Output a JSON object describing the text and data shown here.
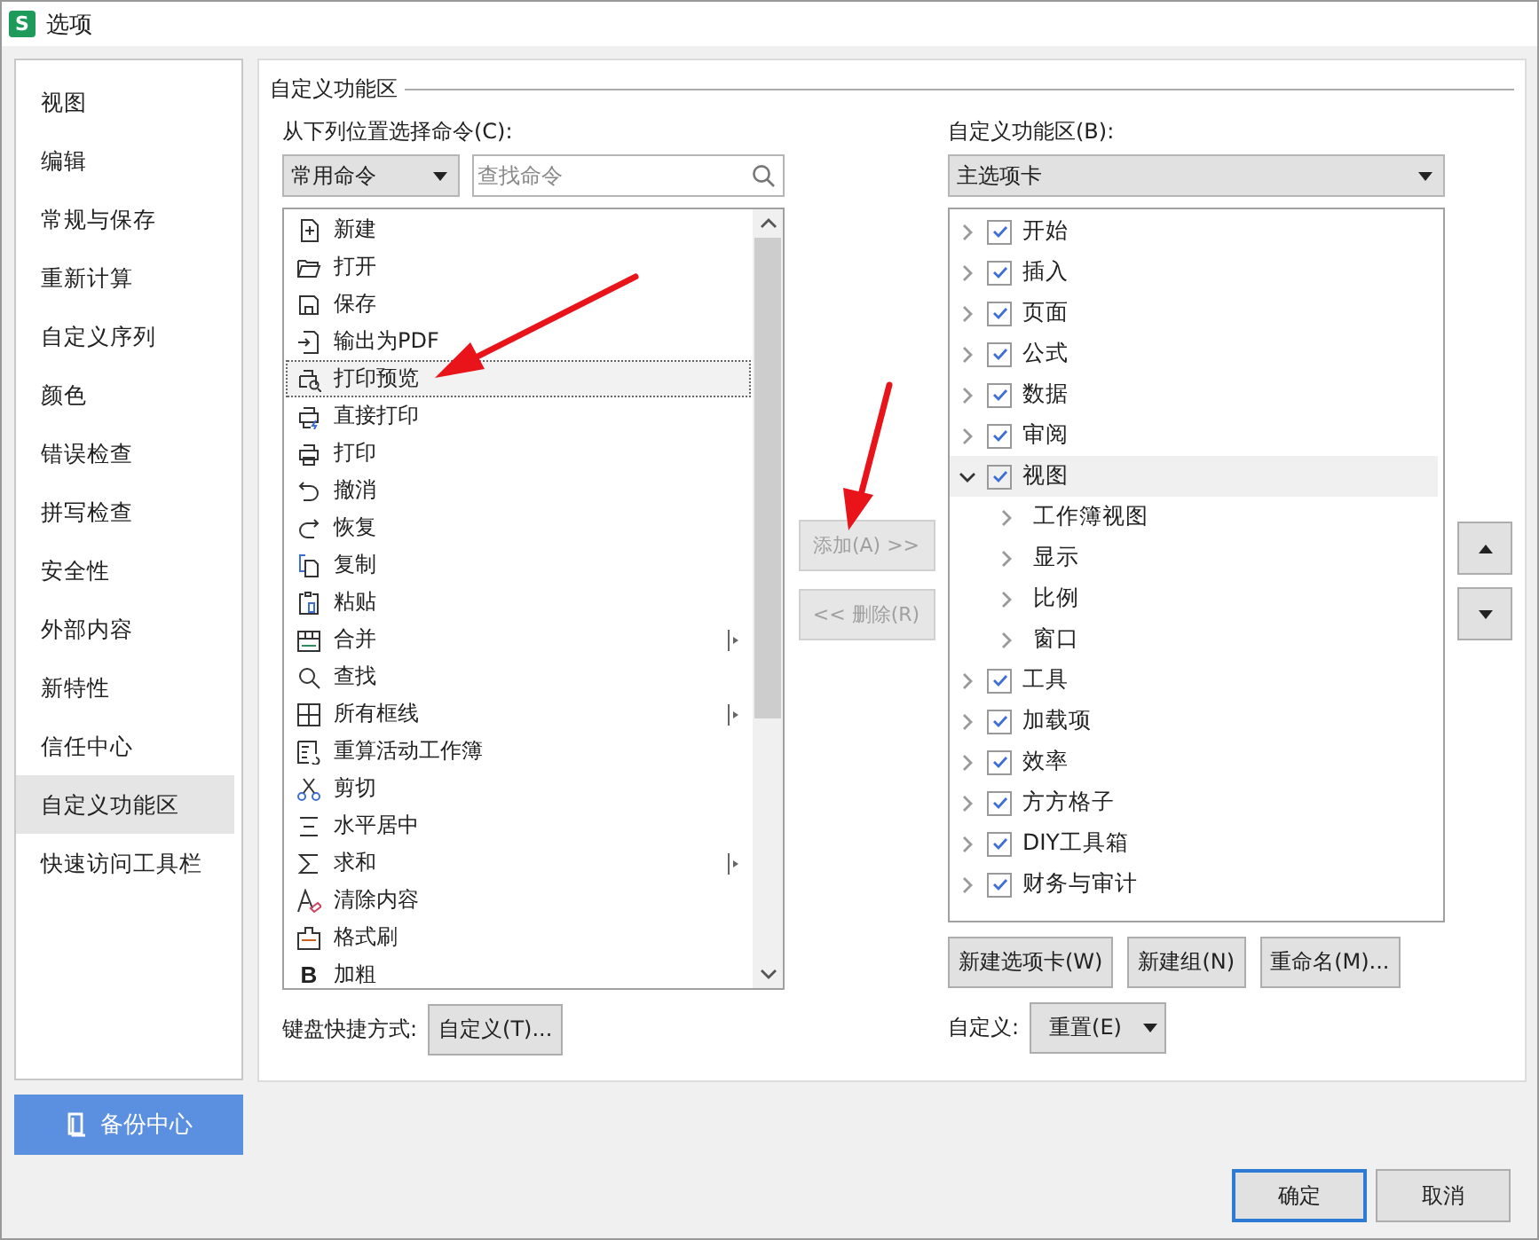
{
  "window": {
    "title": "选项",
    "logo": "S"
  },
  "sidebar": {
    "items": [
      {
        "label": "视图",
        "selected": false
      },
      {
        "label": "编辑",
        "selected": false
      },
      {
        "label": "常规与保存",
        "selected": false
      },
      {
        "label": "重新计算",
        "selected": false
      },
      {
        "label": "自定义序列",
        "selected": false
      },
      {
        "label": "颜色",
        "selected": false
      },
      {
        "label": "错误检查",
        "selected": false
      },
      {
        "label": "拼写检查",
        "selected": false
      },
      {
        "label": "安全性",
        "selected": false
      },
      {
        "label": "外部内容",
        "selected": false
      },
      {
        "label": "新特性",
        "selected": false
      },
      {
        "label": "信任中心",
        "selected": false
      },
      {
        "label": "自定义功能区",
        "selected": true
      },
      {
        "label": "快速访问工具栏",
        "selected": false
      }
    ],
    "backup_button": "备份中心"
  },
  "group_title": "自定义功能区",
  "commands": {
    "label": "从下列位置选择命令(C):",
    "dropdown": "常用命令",
    "search": {
      "placeholder": "查找命令"
    },
    "items": [
      {
        "label": "新建",
        "selected": false,
        "submenu": false
      },
      {
        "label": "打开",
        "selected": false,
        "submenu": false
      },
      {
        "label": "保存",
        "selected": false,
        "submenu": false
      },
      {
        "label": "输出为PDF",
        "selected": false,
        "submenu": false
      },
      {
        "label": "打印预览",
        "selected": true,
        "submenu": false
      },
      {
        "label": "直接打印",
        "selected": false,
        "submenu": false
      },
      {
        "label": "打印",
        "selected": false,
        "submenu": false
      },
      {
        "label": "撤消",
        "selected": false,
        "submenu": false
      },
      {
        "label": "恢复",
        "selected": false,
        "submenu": false
      },
      {
        "label": "复制",
        "selected": false,
        "submenu": false
      },
      {
        "label": "粘贴",
        "selected": false,
        "submenu": false
      },
      {
        "label": "合并",
        "selected": false,
        "submenu": true
      },
      {
        "label": "查找",
        "selected": false,
        "submenu": false
      },
      {
        "label": "所有框线",
        "selected": false,
        "submenu": true
      },
      {
        "label": "重算活动工作簿",
        "selected": false,
        "submenu": false
      },
      {
        "label": "剪切",
        "selected": false,
        "submenu": false
      },
      {
        "label": "水平居中",
        "selected": false,
        "submenu": false
      },
      {
        "label": "求和",
        "selected": false,
        "submenu": true
      },
      {
        "label": "清除内容",
        "selected": false,
        "submenu": false
      },
      {
        "label": "格式刷",
        "selected": false,
        "submenu": false
      },
      {
        "label": "加粗",
        "selected": false,
        "submenu": false,
        "glyph": "B"
      }
    ],
    "shortcut_label": "键盘快捷方式:",
    "shortcut_button": "自定义(T)..."
  },
  "middle_buttons": [
    {
      "label": "添加(A) >>",
      "disabled": true
    },
    {
      "label": "<< 删除(R)",
      "disabled": true
    }
  ],
  "ribbon": {
    "label": "自定义功能区(B):",
    "dropdown": "主选项卡",
    "tabs": [
      {
        "label": "开始",
        "checked": true,
        "expanded": false,
        "selected": false
      },
      {
        "label": "插入",
        "checked": true,
        "expanded": false,
        "selected": false
      },
      {
        "label": "页面",
        "checked": true,
        "expanded": false,
        "selected": false
      },
      {
        "label": "公式",
        "checked": true,
        "expanded": false,
        "selected": false
      },
      {
        "label": "数据",
        "checked": true,
        "expanded": false,
        "selected": false
      },
      {
        "label": "审阅",
        "checked": true,
        "expanded": false,
        "selected": false
      },
      {
        "label": "视图",
        "checked": true,
        "expanded": true,
        "selected": true,
        "children": [
          {
            "label": "工作簿视图"
          },
          {
            "label": "显示"
          },
          {
            "label": "比例"
          },
          {
            "label": "窗口"
          }
        ]
      },
      {
        "label": "工具",
        "checked": true,
        "expanded": false,
        "selected": false
      },
      {
        "label": "加载项",
        "checked": true,
        "expanded": false,
        "selected": false
      },
      {
        "label": "效率",
        "checked": true,
        "expanded": false,
        "selected": false
      },
      {
        "label": "方方格子",
        "checked": true,
        "expanded": false,
        "selected": false
      },
      {
        "label": "DIY工具箱",
        "checked": true,
        "expanded": false,
        "selected": false
      },
      {
        "label": "财务与审计",
        "checked": true,
        "expanded": false,
        "selected": false
      }
    ],
    "buttons": [
      "新建选项卡(W)",
      "新建组(N)",
      "重命名(M)..."
    ],
    "reset_label": "自定义:",
    "reset_button": "重置(E)"
  },
  "footer_buttons": [
    {
      "label": "确定",
      "default": true
    },
    {
      "label": "取消",
      "default": false
    }
  ]
}
